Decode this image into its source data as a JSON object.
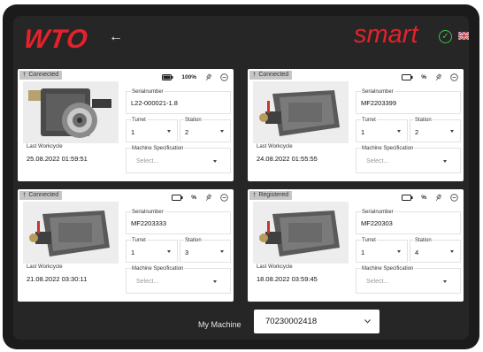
{
  "header": {
    "logo": "WTO",
    "brand": "smart",
    "back_icon": "arrow-left-icon",
    "status_icon": "check-circle-icon",
    "language_icon": "uk-flag-icon"
  },
  "labels": {
    "serial": "Serialnumber",
    "turret": "Turret",
    "station": "Station",
    "spec": "Machine Specification",
    "last_workcycle": "Last Workcycle"
  },
  "cards": [
    {
      "status": "Connected",
      "battery_text": "100%",
      "battery_full": true,
      "serial": "L22-000021-1.8",
      "turret": "1",
      "station": "2",
      "spec_placeholder": "Select...",
      "last_workcycle": "25.08.2022 01:59:51"
    },
    {
      "status": "Connected",
      "battery_text": "%",
      "battery_full": false,
      "serial": "MF2203399",
      "turret": "1",
      "station": "2",
      "spec_placeholder": "Select...",
      "last_workcycle": "24.08.2022 01:55:55"
    },
    {
      "status": "Connected",
      "battery_text": "%",
      "battery_full": false,
      "serial": "MF2203333",
      "turret": "1",
      "station": "3",
      "spec_placeholder": "Select...",
      "last_workcycle": "21.08.2022 03:30:11"
    },
    {
      "status": "Registered",
      "battery_text": "%",
      "battery_full": false,
      "serial": "MF220303",
      "turret": "1",
      "station": "4",
      "spec_placeholder": "Select...",
      "last_workcycle": "18.08.2022 03:59:45"
    }
  ],
  "footer": {
    "label": "My Machine",
    "machine": "70230002418"
  },
  "colors": {
    "brand_red": "#e3222b",
    "ok_green": "#3cc24a"
  }
}
